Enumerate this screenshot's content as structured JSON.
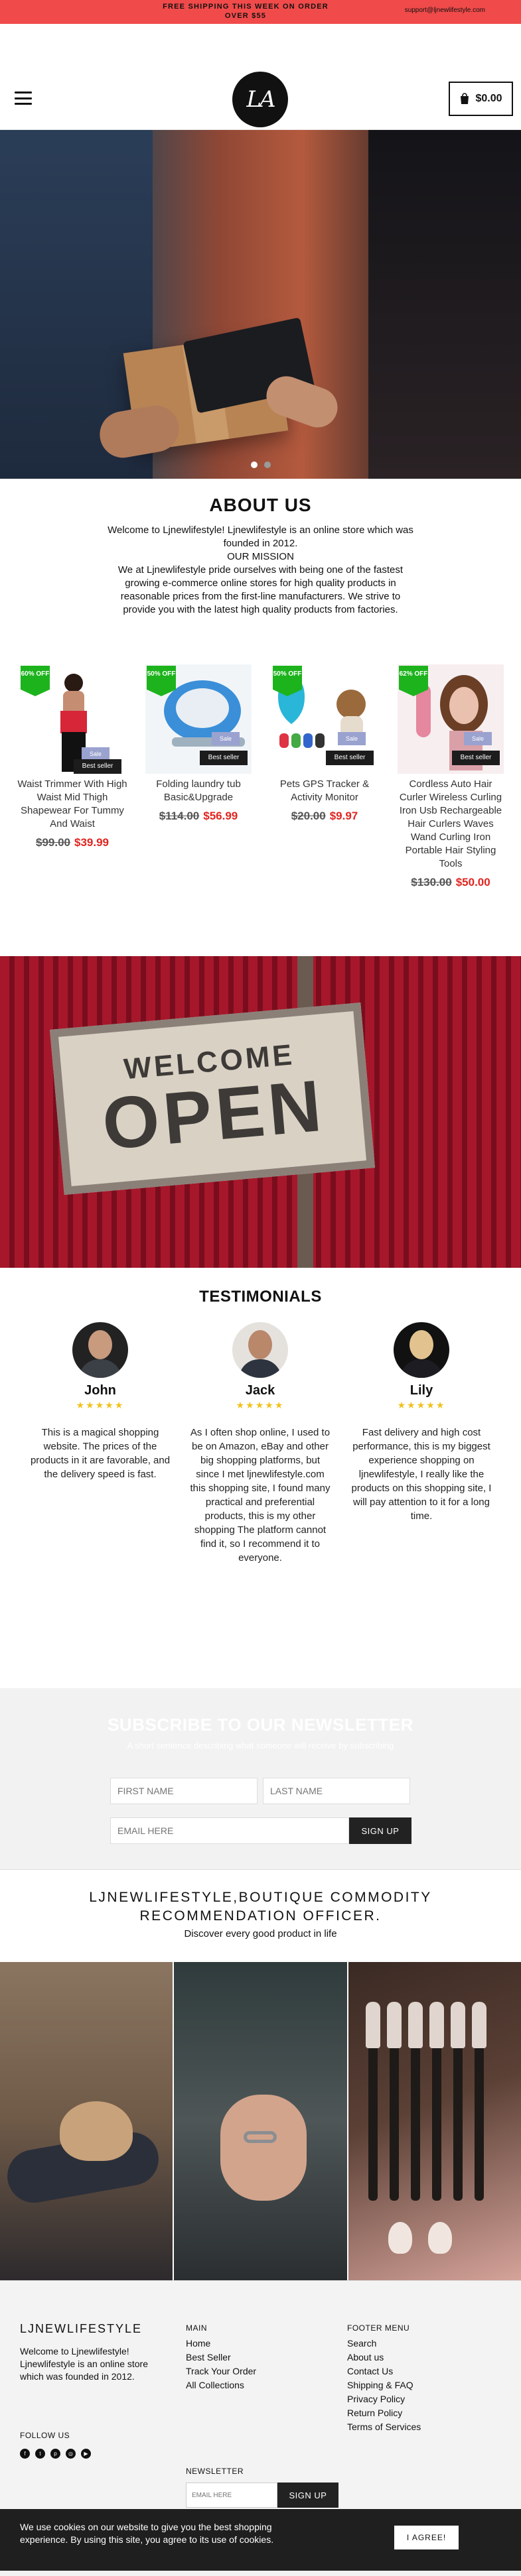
{
  "announcement": {
    "message": "FREE SHIPPING THIS WEEK ON ORDER OVER $55",
    "email": "support@ljnewlifestyle.com"
  },
  "header": {
    "logo_text": "LA",
    "cart_total": "$0.00"
  },
  "hero": {
    "slide_count": 2,
    "active_slide": 1
  },
  "about": {
    "title": "ABOUT US",
    "intro": "Welcome to Ljnewlifestyle! Ljnewlifestyle is an online store which was founded in 2012.",
    "mission_label": "OUR MISSION",
    "mission_text": "We at Ljnewlifestyle pride ourselves with being one of the fastest growing e-commerce online stores for high quality products in reasonable prices from the first-line manufacturers. We strive to provide you with the latest high quality products from factories."
  },
  "products": [
    {
      "discount": "60% OFF",
      "sale": "Sale",
      "badge": "Best seller",
      "name": "Waist Trimmer With High Waist Mid Thigh Shapewear For Tummy And Waist",
      "old_price": "$99.00",
      "price": "$39.99"
    },
    {
      "discount": "50% OFF",
      "sale": "Sale",
      "badge": "Best seller",
      "name": "Folding laundry tub Basic&Upgrade",
      "old_price": "$114.00",
      "price": "$56.99"
    },
    {
      "discount": "50% OFF",
      "sale": "Sale",
      "badge": "Best seller",
      "name": "Pets GPS Tracker & Activity Monitor",
      "old_price": "$20.00",
      "price": "$9.97"
    },
    {
      "discount": "62% OFF",
      "sale": "Sale",
      "badge": "Best seller",
      "name": "Cordless Auto Hair Curler Wireless Curling Iron Usb Rechargeable Hair Curlers Waves Wand Curling Iron Portable Hair Styling Tools",
      "old_price": "$130.00",
      "price": "$50.00"
    }
  ],
  "welcome_sign": {
    "line1": "WELCOME",
    "line2": "OPEN"
  },
  "testimonials": {
    "title": "TESTIMONIALS",
    "stars": "★★★★★",
    "items": [
      {
        "name": "John",
        "quote": "This is a magical shopping website. The prices of the products in it are favorable, and the delivery speed is fast."
      },
      {
        "name": "Jack",
        "quote": "As I often shop online, I used to be on Amazon, eBay and other big shopping platforms, but since I met ljnewlifestyle.com this shopping site, I found many practical and preferential products, this is my other shopping The platform cannot find it, so I recommend it to everyone."
      },
      {
        "name": "Lily",
        "quote": "Fast delivery and high cost performance, this is my biggest experience shopping on ljnewlifestyle, I really like the products on this shopping site, I will pay attention to it for a long time."
      }
    ]
  },
  "newsletter": {
    "title": "SUBSCRIBE TO OUR NEWSLETTER",
    "subtitle": "A short sentence describing what someone will receive by subscribing",
    "first_name_placeholder": "FIRST NAME",
    "last_name_placeholder": "LAST NAME",
    "email_placeholder": "EMAIL HERE",
    "button": "SIGN UP"
  },
  "boutique": {
    "title": "LJNEWLIFESTYLE,BOUTIQUE COMMODITY RECOMMENDATION OFFICER.",
    "subtitle": "Discover every good product in life"
  },
  "footer": {
    "brand": "LJNEWLIFESTYLE",
    "description": "Welcome to Ljnewlifestyle! Ljnewlifestyle is an online store which was founded in 2012.",
    "follow_us": "FOLLOW US",
    "main_title": "MAIN",
    "main_links": [
      "Home",
      "Best Seller",
      "Track Your Order",
      "All Collections"
    ],
    "menu_title": "FOOTER MENU",
    "menu_links": [
      "Search",
      "About us",
      "Contact Us",
      "Shipping & FAQ",
      "Privacy Policy",
      "Return Policy",
      "Terms of Services"
    ],
    "newsletter_title": "NEWSLETTER",
    "newsletter_placeholder": "EMAIL HERE",
    "newsletter_button": "SIGN UP"
  },
  "cookie": {
    "text": "We use cookies on our website to give you the best shopping experience. By using this site, you agree to its use of cookies.",
    "button": "I AGREE!"
  },
  "colors": {
    "announcement_bg": "#f04a4a",
    "price_red": "#e1241f",
    "discount_green": "#1db31d",
    "star_gold": "#f0c21c"
  }
}
